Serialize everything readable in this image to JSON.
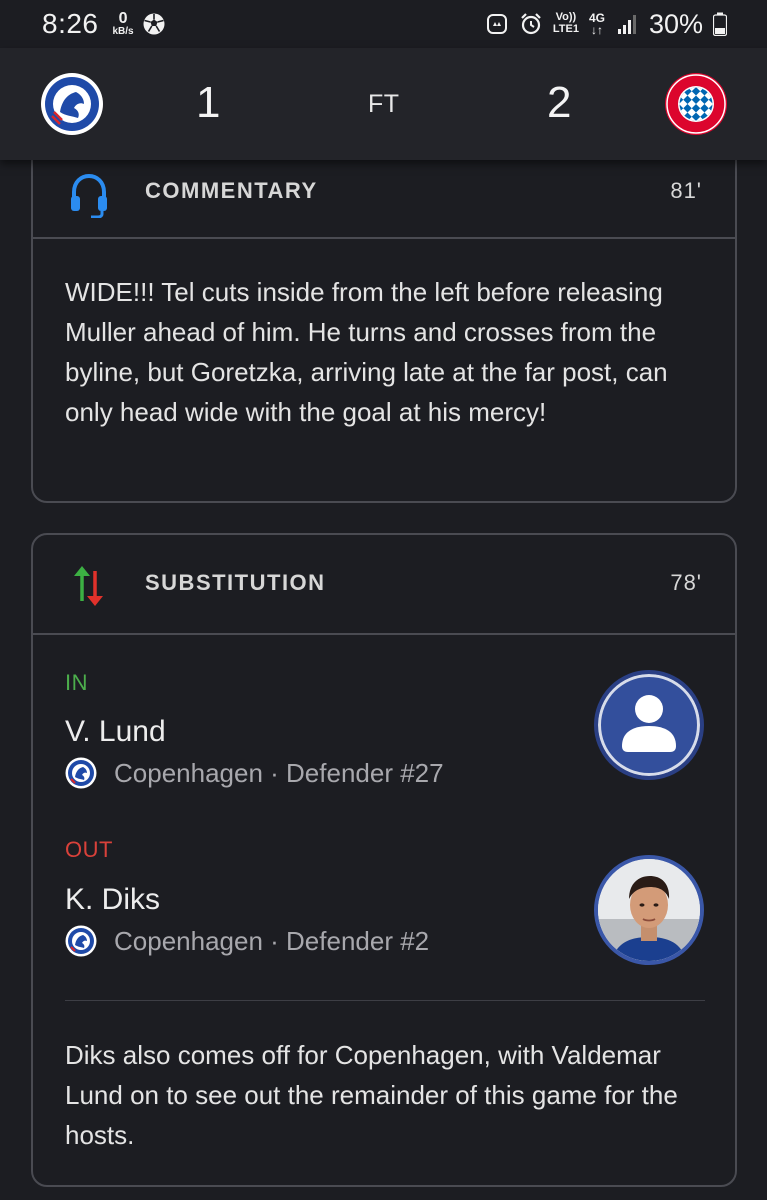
{
  "status_bar": {
    "time": "8:26",
    "net_speed_value": "0",
    "net_speed_unit": "kB/s",
    "volte_top": "Vo))",
    "volte_bottom": "LTE1",
    "network_type": "4G",
    "battery_percent": "30%"
  },
  "match": {
    "home_score": "1",
    "away_score": "2",
    "status": "FT",
    "home_crest_text": "F.C. KØBENHAVN",
    "away_crest_text": "FC BAYERN MÜNCHEN"
  },
  "commentary": {
    "title": "COMMENTARY",
    "minute": "81'",
    "text": "WIDE!!! Tel cuts inside from the left before releasing Muller ahead of him. He turns and crosses from the byline, but Goretzka, arriving late at the far post, can only head wide with the goal at his mercy!"
  },
  "substitution": {
    "title": "SUBSTITUTION",
    "minute": "78'",
    "in": {
      "label": "IN",
      "name": "V. Lund",
      "meta": "Copenhagen · Defender #27"
    },
    "out": {
      "label": "OUT",
      "name": "K. Diks",
      "meta": "Copenhagen · Defender #2"
    },
    "text": "Diks also comes off for Copenhagen, with Valdemar Lund on to see out the remainder of this game for the hosts."
  },
  "colors": {
    "background": "#1c1d22",
    "header": "#232429",
    "in_green": "#4cae4c",
    "out_red": "#d9413a",
    "headphone_blue": "#2b8cf0"
  }
}
